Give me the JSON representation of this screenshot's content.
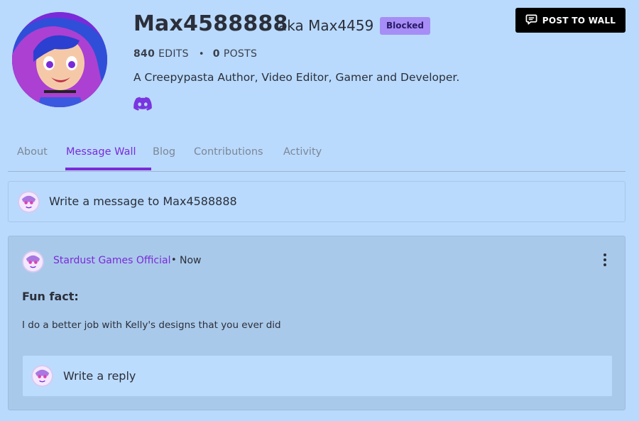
{
  "profile": {
    "username": "Max4588888",
    "aka_label": "aka",
    "aka_name": "Max4459",
    "status_badge": "Blocked",
    "edits_count": "840",
    "edits_label": "EDITS",
    "posts_count": "0",
    "posts_label": "POSTS",
    "bio": "A Creepypasta Author, Video Editor, Gamer and Developer.",
    "social_icon": "discord-icon"
  },
  "header": {
    "post_button_label": "POST TO WALL",
    "post_button_icon": "message-bubble-icon"
  },
  "tabs": [
    {
      "label": "About",
      "active": false
    },
    {
      "label": "Message Wall",
      "active": true
    },
    {
      "label": "Blog",
      "active": false
    },
    {
      "label": "Contributions",
      "active": false
    },
    {
      "label": "Activity",
      "active": false
    }
  ],
  "compose": {
    "placeholder": "Write a message to Max4588888"
  },
  "thread": {
    "author": "Stardust Games Official",
    "separator": "•",
    "timestamp": "Now",
    "title": "Fun fact:",
    "body": "I do a better job with Kelly's designs that you ever did",
    "reply_placeholder": "Write a reply"
  },
  "colors": {
    "background": "#b9dafd",
    "accent": "#7a2bd9",
    "badge": "#a68ef6",
    "card": "#a9c9ea",
    "button": "#000000",
    "discord": "#7a35e0"
  }
}
